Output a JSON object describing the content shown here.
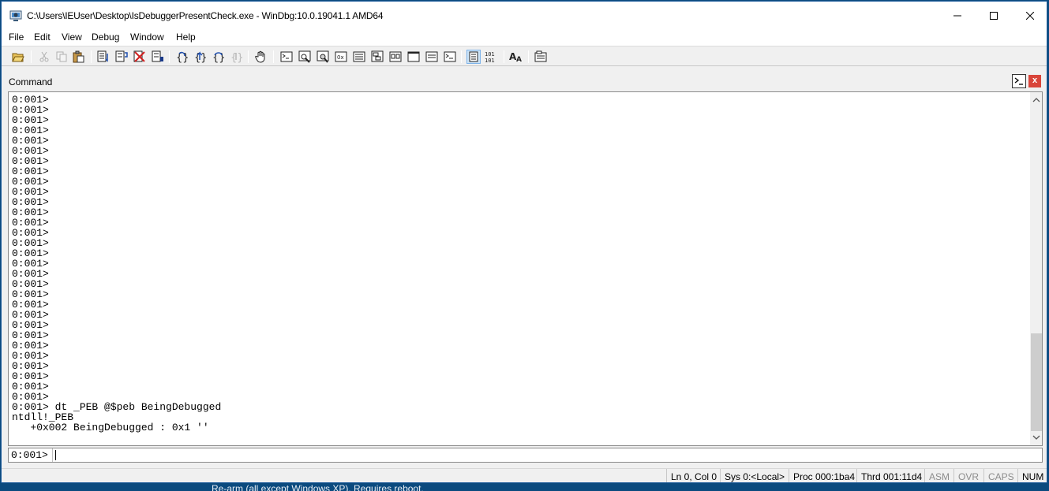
{
  "window": {
    "title": "C:\\Users\\IEUser\\Desktop\\IsDebuggerPresentCheck.exe - WinDbg:10.0.19041.1 AMD64"
  },
  "menu": [
    "File",
    "Edit",
    "View",
    "Debug",
    "Window",
    "Help"
  ],
  "toolbar": {
    "icons": [
      "open-icon",
      "cut-icon",
      "copy-icon",
      "paste-icon",
      "source-mode-icon",
      "step-into-icon",
      "break-icon",
      "stop-icon",
      "step-over-icon",
      "step-out-icon",
      "run-to-cursor-icon",
      "return-icon",
      "hand-icon",
      "command-icon",
      "watch-icon",
      "locals-icon",
      "registers-icon",
      "memory-icon",
      "call-stack-icon",
      "disassembly-icon",
      "scratch-pad-icon",
      "processes-icon",
      "source-icon",
      "binary-icon",
      "font-icon",
      "options-icon"
    ]
  },
  "panel": {
    "title": "Command",
    "close_label": "x"
  },
  "output": {
    "lines": [
      "0:001>",
      "0:001>",
      "0:001>",
      "0:001>",
      "0:001>",
      "0:001>",
      "0:001>",
      "0:001>",
      "0:001>",
      "0:001>",
      "0:001>",
      "0:001>",
      "0:001>",
      "0:001>",
      "0:001>",
      "0:001>",
      "0:001>",
      "0:001>",
      "0:001>",
      "0:001>",
      "0:001>",
      "0:001>",
      "0:001>",
      "0:001>",
      "0:001>",
      "0:001>",
      "0:001>",
      "0:001>",
      "0:001>",
      "0:001>",
      "0:001> dt _PEB @$peb BeingDebugged",
      "ntdll!_PEB",
      "   +0x002 BeingDebugged : 0x1 ''"
    ]
  },
  "command": {
    "prompt": "0:001>",
    "value": ""
  },
  "status": {
    "position": "Ln 0, Col 0",
    "sys": "Sys 0:<Local>",
    "proc": "Proc 000:1ba4",
    "thrd": "Thrd 001:11d4",
    "asm": "ASM",
    "ovr": "OVR",
    "caps": "CAPS",
    "num": "NUM"
  },
  "background_text": "Re-arm (all except Windows XP). Requires reboot."
}
